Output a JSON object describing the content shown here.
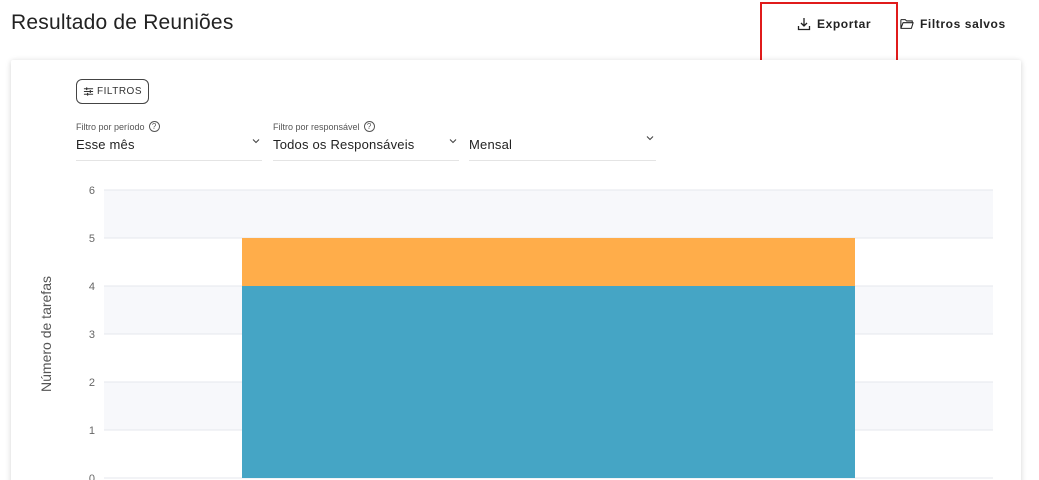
{
  "header": {
    "title": "Resultado de Reuniões",
    "export_label": "Exportar",
    "saved_filters_label": "Filtros salvos"
  },
  "filters": {
    "button_label": "FILTROS",
    "period": {
      "label": "Filtro por período",
      "value": "Esse mês"
    },
    "responsible": {
      "label": "Filtro por responsável",
      "value": "Todos os Responsáveis"
    },
    "frequency": {
      "value": "Mensal"
    }
  },
  "colors": {
    "highlight": "#e01b1b",
    "bar_blue": "#45a5c5",
    "bar_orange": "#ffad4a",
    "band": "#f7f8fb"
  },
  "chart_data": {
    "type": "bar",
    "stacked": true,
    "ylabel": "Número de tarefas",
    "ylim": [
      0,
      6
    ],
    "yticks": [
      "0",
      "1",
      "2",
      "3",
      "4",
      "5",
      "6"
    ],
    "categories": [
      ""
    ],
    "series": [
      {
        "values": [
          4
        ],
        "color": "#45a5c5"
      },
      {
        "values": [
          1
        ],
        "color": "#ffad4a"
      }
    ],
    "grid": true
  }
}
